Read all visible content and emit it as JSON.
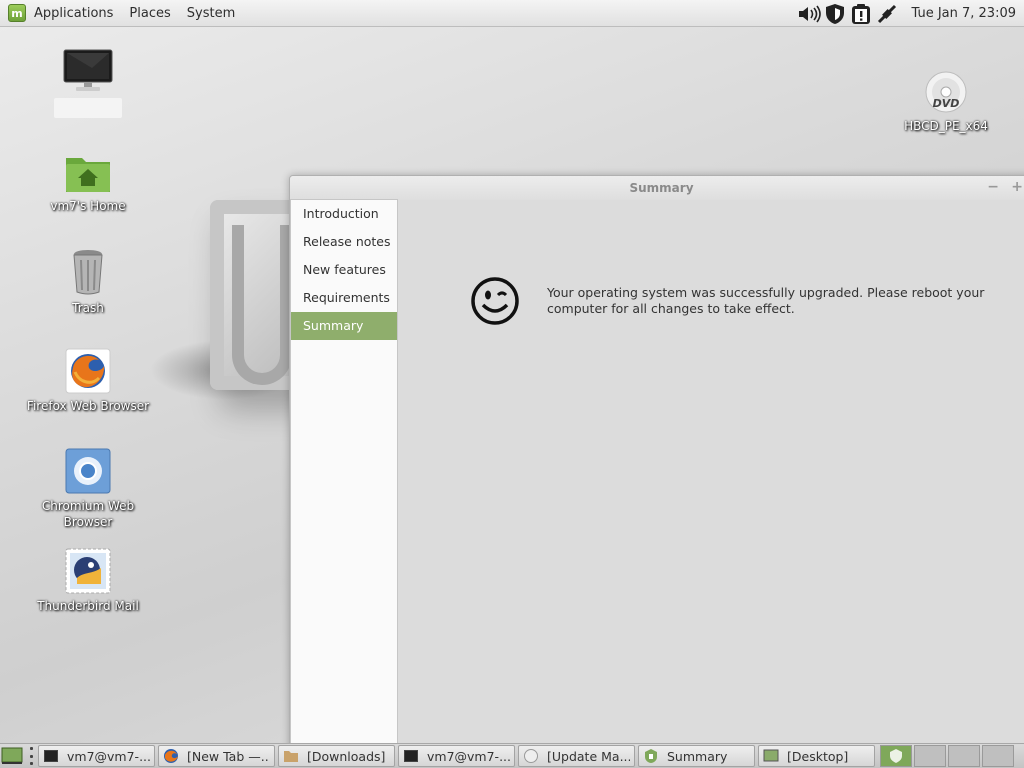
{
  "top_panel": {
    "menus": [
      "Applications",
      "Places",
      "System"
    ],
    "clock": "Tue Jan  7, 23:09",
    "tray_icons": [
      "volume-icon",
      "shield-icon",
      "update-manager-icon",
      "network-icon"
    ]
  },
  "desktop": {
    "icons": [
      {
        "name": "computer",
        "label": ""
      },
      {
        "name": "home",
        "label": "vm7's Home"
      },
      {
        "name": "trash",
        "label": "Trash"
      },
      {
        "name": "firefox",
        "label": "Firefox Web Browser"
      },
      {
        "name": "chromium",
        "label": "Chromium Web Browser"
      },
      {
        "name": "thunderbird",
        "label": "Thunderbird Mail"
      },
      {
        "name": "dvd",
        "label": "HBCD_PE_x64"
      }
    ],
    "dvd_badge": "DVD"
  },
  "window": {
    "title": "Summary",
    "sidebar": [
      {
        "label": "Introduction",
        "active": false
      },
      {
        "label": "Release notes",
        "active": false
      },
      {
        "label": "New features",
        "active": false
      },
      {
        "label": "Requirements",
        "active": false
      },
      {
        "label": "Summary",
        "active": true
      }
    ],
    "message": "Your operating system was successfully upgraded. Please reboot your computer for all changes to take effect."
  },
  "taskbar": {
    "tasks": [
      {
        "label": "vm7@vm7-..."
      },
      {
        "label": "[New Tab —..."
      },
      {
        "label": "[Downloads]"
      },
      {
        "label": "vm7@vm7-..."
      },
      {
        "label": "[Update Ma..."
      },
      {
        "label": "Summary"
      },
      {
        "label": "[Desktop]"
      }
    ]
  },
  "colors": {
    "accent": "#8fae6c",
    "mint_green": "#7fa85a"
  }
}
